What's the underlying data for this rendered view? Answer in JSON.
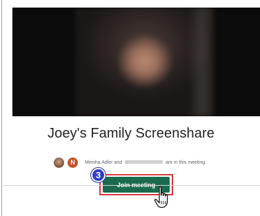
{
  "meeting": {
    "title": "Joey's Family Screenshare"
  },
  "attendees": {
    "avatar_initial": "N",
    "text_before": "Meisha Adler and",
    "text_after": "are in this meeting"
  },
  "join_button": {
    "label": "Join meeting"
  },
  "annotation": {
    "step_number": "3"
  },
  "icons": {
    "cursor": "hand-pointer-icon"
  },
  "colors": {
    "join_button": "#1a6b4c",
    "highlight_border": "#d9343a",
    "step_badge": "#2f3dc9",
    "avatar_letter_bg": "#c2512b"
  }
}
